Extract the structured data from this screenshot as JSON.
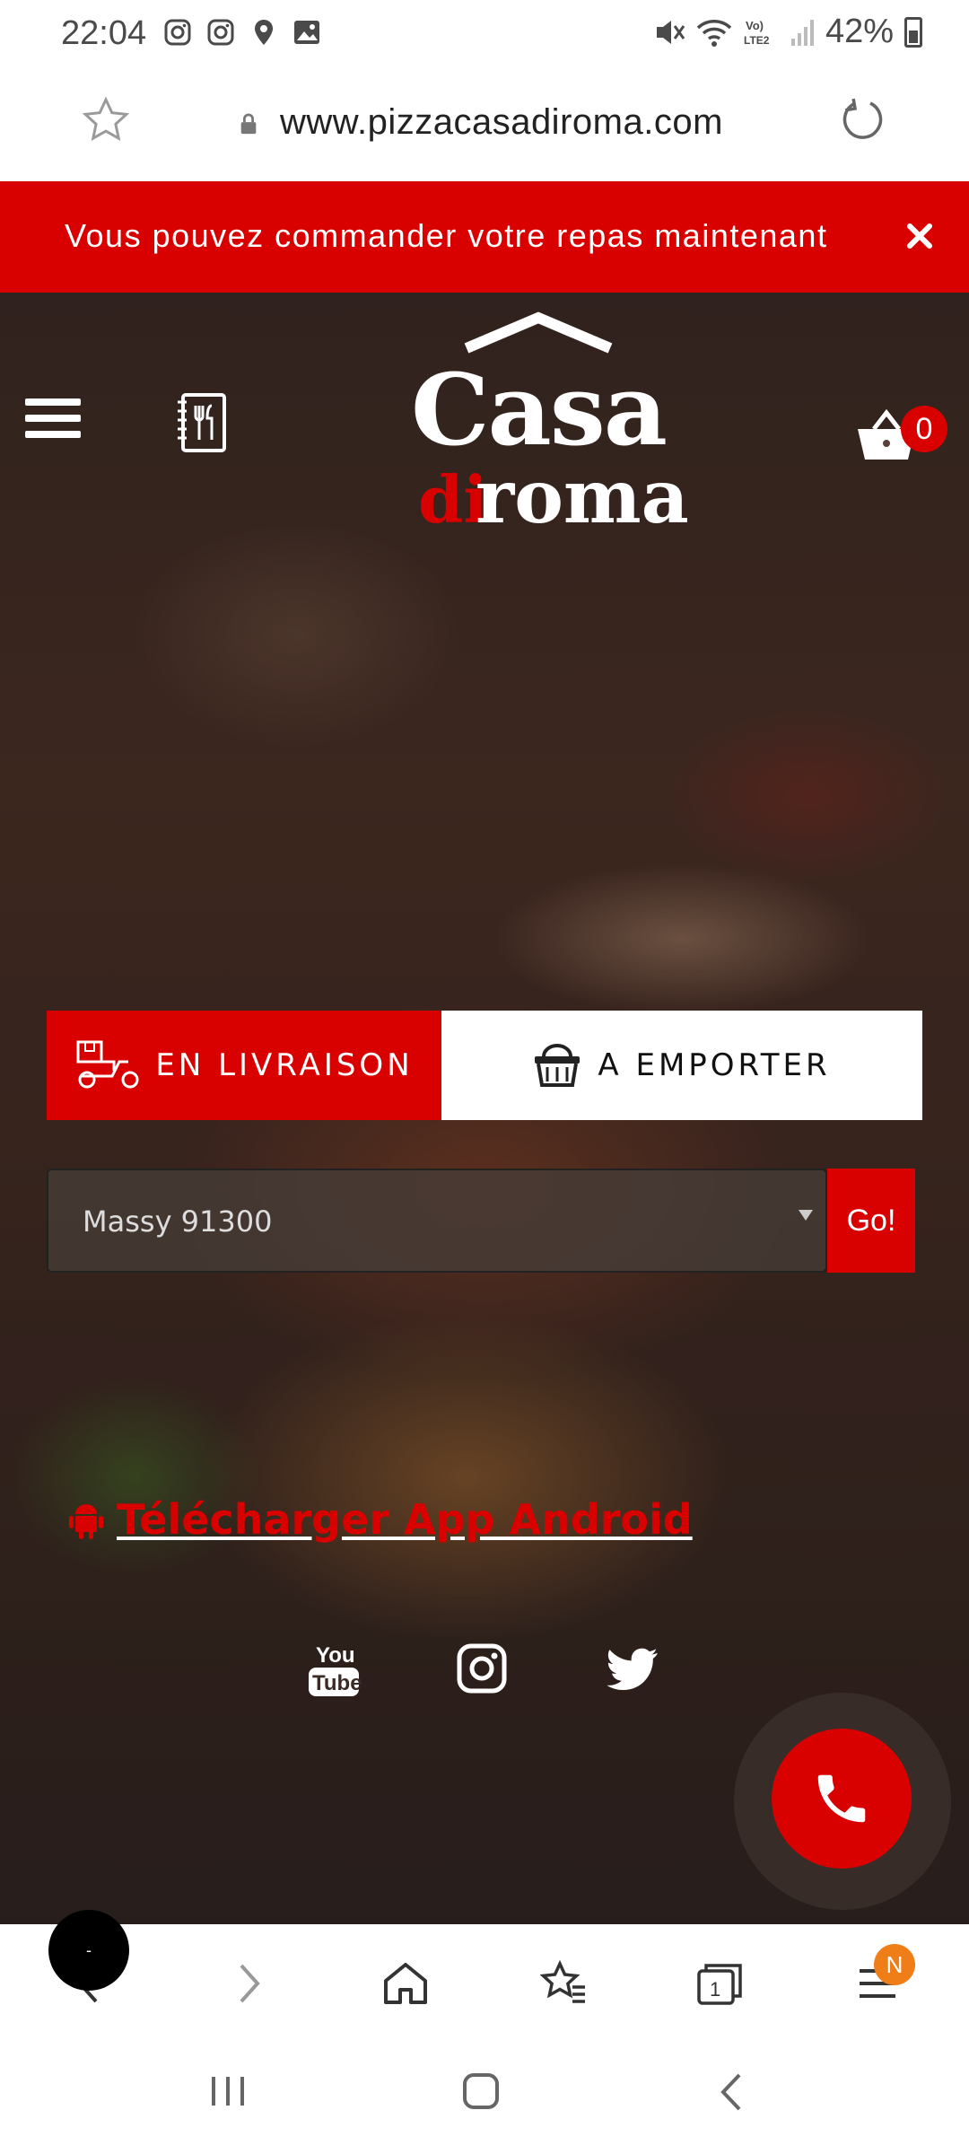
{
  "status_bar": {
    "time": "22:04",
    "battery": "42%",
    "left_icons": [
      "instagram-icon",
      "instagram-icon",
      "location-icon",
      "image-icon"
    ],
    "right_icons": [
      "mute-icon",
      "wifi-icon",
      "volte-icon",
      "signal-icon",
      "battery-icon"
    ]
  },
  "browser": {
    "url": "www.pizzacasadiroma.com"
  },
  "banner": {
    "text": "Vous pouvez commander votre repas maintenant"
  },
  "header": {
    "logo_casa": "Casa",
    "logo_di": "di",
    "logo_roma": "roma",
    "cart_count": "0"
  },
  "order_tabs": {
    "delivery": "EN LIVRAISON",
    "takeaway": "A EMPORTER"
  },
  "location_select": {
    "value": "Massy 91300",
    "go_label": "Go!"
  },
  "android_link": {
    "label": "Télécharger App Android"
  },
  "browser_nav": {
    "floating_label": "-",
    "menu_badge": "N"
  },
  "colors": {
    "brand_red": "#d90000",
    "badge_orange": "#f07e18"
  }
}
